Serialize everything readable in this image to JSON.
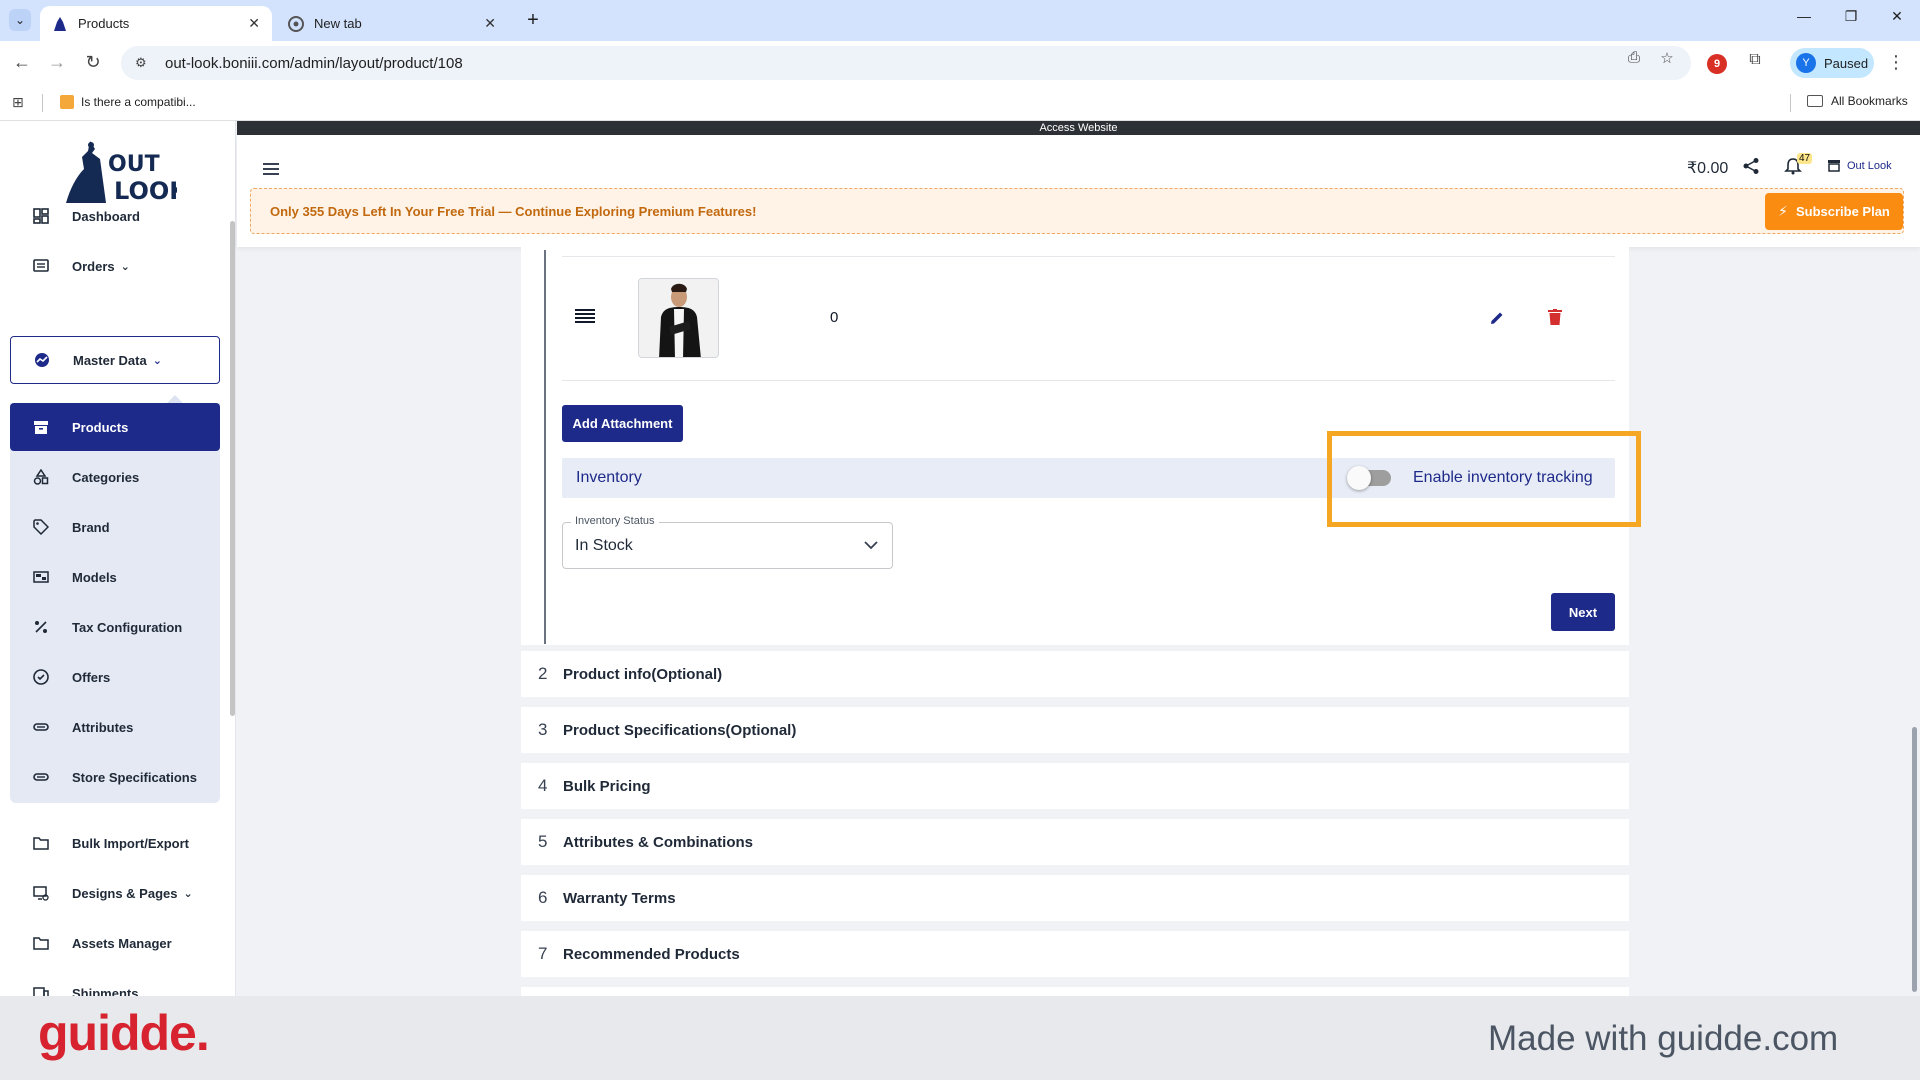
{
  "browser": {
    "tabs": [
      {
        "label": "Products",
        "active": true
      },
      {
        "label": "New tab",
        "active": false
      }
    ],
    "url": "out-look.boniii.com/admin/layout/product/108",
    "profile_initial": "Y",
    "profile_status": "Paused",
    "extension_badge": "9",
    "bookmark_item": "Is there a compatibi...",
    "all_bookmarks": "All Bookmarks"
  },
  "access_strip": "Access Website",
  "sidebar": {
    "logo_text_top": "OUT",
    "logo_text_bottom": "LOOK",
    "items": [
      {
        "label": "Dashboard",
        "icon": "dashboard-icon"
      },
      {
        "label": "Orders",
        "icon": "orders-icon",
        "has_chevron": true
      },
      {
        "label": "Master Data",
        "icon": "master-data-icon",
        "has_chevron": true,
        "state": "expanded"
      },
      {
        "label": "Products",
        "icon": "products-icon",
        "state": "active"
      },
      {
        "label": "Categories",
        "icon": "categories-icon"
      },
      {
        "label": "Brand",
        "icon": "tag-icon"
      },
      {
        "label": "Models",
        "icon": "models-icon"
      },
      {
        "label": "Tax Configuration",
        "icon": "percent-icon"
      },
      {
        "label": "Offers",
        "icon": "offers-icon"
      },
      {
        "label": "Attributes",
        "icon": "attributes-icon"
      },
      {
        "label": "Store Specifications",
        "icon": "store-spec-icon"
      },
      {
        "label": "Bulk Import/Export",
        "icon": "folder-icon"
      },
      {
        "label": "Designs & Pages",
        "icon": "designs-icon",
        "has_chevron": true
      },
      {
        "label": "Assets Manager",
        "icon": "folder-icon"
      },
      {
        "label": "Shipments",
        "icon": "shipments-icon"
      }
    ]
  },
  "header": {
    "amount": "₹0.00",
    "notification_count": "47",
    "store_name": "Out Look"
  },
  "trial_banner": {
    "message": "Only 355 Days Left In Your Free Trial — Continue Exploring Premium Features!",
    "button": "Subscribe Plan"
  },
  "attachment_row": {
    "quantity": "0"
  },
  "add_attachment_label": "Add Attachment",
  "inventory": {
    "title": "Inventory",
    "toggle_label": "Enable inventory tracking",
    "toggle_on": false,
    "status_label": "Inventory Status",
    "status_value": "In Stock"
  },
  "next_label": "Next",
  "steps": [
    {
      "num": "2",
      "title": "Product info(Optional)"
    },
    {
      "num": "3",
      "title": "Product Specifications(Optional)"
    },
    {
      "num": "4",
      "title": "Bulk Pricing"
    },
    {
      "num": "5",
      "title": "Attributes & Combinations"
    },
    {
      "num": "6",
      "title": "Warranty Terms"
    },
    {
      "num": "7",
      "title": "Recommended Products"
    }
  ],
  "footer": {
    "logo": "guidde.",
    "tagline": "Made with guidde.com"
  },
  "colors": {
    "primary": "#1e2a8a",
    "highlight": "#f5a623",
    "subscribe": "#fb8c12",
    "banner_text": "#c2680e"
  }
}
